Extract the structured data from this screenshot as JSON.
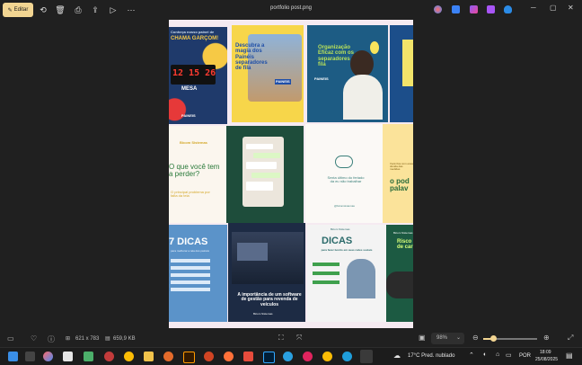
{
  "toolbar": {
    "edit_label": "Editar",
    "file_name": "portfolio post.png",
    "more_icon": "more-horizontal-icon"
  },
  "posts": {
    "p1": {
      "line1": "Conheça nosso painel de",
      "line2": "CHAMA GARÇOM!",
      "clock": "12 15 26",
      "mesa": "MESA",
      "brand": "PAINEIS"
    },
    "p2": {
      "title": "Descubra a magia dos Painéis separadores de fila",
      "badge": "PAINEIS"
    },
    "p3": {
      "title": "Organização Eficaz com os separadores de fila",
      "brand": "PAINEIS"
    },
    "p5": {
      "logo": "Bicom Sistemas",
      "title": "O que você tem a perder?",
      "sub": "O principal problema por falta da tela"
    },
    "p7": {
      "caption": "Sexta último do feriado da eu não trabalhar",
      "handle": "@bicomsistemas"
    },
    "p8": {
      "small": "Você fica com essa dúvida das medidas",
      "big": "o pod palav"
    },
    "p9": {
      "title": "7 DICAS",
      "sub": "para melhorar a tela dos painéis"
    },
    "p10": {
      "title": "A importância de um software de gestão para revenda de veículos",
      "logo": "Bicom Sistemas"
    },
    "p11": {
      "logo": "Bicom Sistemas",
      "title": "DICAS",
      "sub": "para fazer bonito em suas redes sociais"
    },
    "p12": {
      "logo": "Bicom Sistemas",
      "title": "Risco de car"
    }
  },
  "status": {
    "dimensions": "621 x 783",
    "filesize": "659,9 KB",
    "zoom": "98%"
  },
  "taskbar": {
    "weather": "17°C  Pred. nublado",
    "lang": "POR",
    "time": "18:09",
    "date": "25/08/2025"
  },
  "colors": {
    "accent": "#f2d592",
    "canvas": "#f5eaf1"
  }
}
